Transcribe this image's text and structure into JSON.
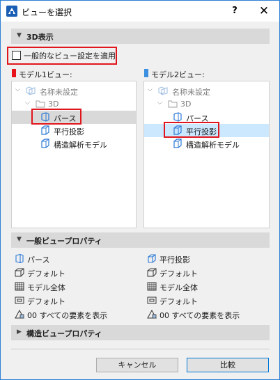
{
  "window": {
    "title": "ビューを選択",
    "help_label": "?",
    "close_label": "✕"
  },
  "section_3d": {
    "label": "3D表示"
  },
  "general_checkbox": {
    "label": "一般的なビュー設定を適用",
    "checked": false
  },
  "model1": {
    "header": "モデル1ビュー:",
    "color": "#e8141b",
    "tree": [
      {
        "label": "名称未設定"
      },
      {
        "label": "3D"
      },
      {
        "label": "パース",
        "selected": true
      },
      {
        "label": "平行投影"
      },
      {
        "label": "構造解析モデル"
      }
    ]
  },
  "model2": {
    "header": "モデル2ビュー:",
    "color": "#3d8fe0",
    "tree": [
      {
        "label": "名称未設定"
      },
      {
        "label": "3D"
      },
      {
        "label": "パース"
      },
      {
        "label": "平行投影",
        "selected": true
      },
      {
        "label": "構造解析モデル"
      }
    ]
  },
  "general_props": {
    "label": "一般ビュープロパティ",
    "left": [
      {
        "icon": "perspective-icon",
        "label": "パース"
      },
      {
        "icon": "camera-setting-icon",
        "label": "デフォルト"
      },
      {
        "icon": "model-extent-icon",
        "label": "モデル全体"
      },
      {
        "icon": "display-icon",
        "label": "デフォルト"
      },
      {
        "icon": "layer-icon",
        "label": "00 すべての要素を表示"
      }
    ],
    "right": [
      {
        "icon": "parallel-icon",
        "label": "平行投影"
      },
      {
        "icon": "camera-setting-icon",
        "label": "デフォルト"
      },
      {
        "icon": "model-extent-icon",
        "label": "モデル全体"
      },
      {
        "icon": "display-icon",
        "label": "デフォルト"
      },
      {
        "icon": "layer-icon",
        "label": "00 すべての要素を表示"
      }
    ]
  },
  "structural_props": {
    "label": "構造ビュープロパティ"
  },
  "buttons": {
    "cancel": "キャンセル",
    "compare": "比較"
  },
  "colors": {
    "highlight": "#e0161c",
    "selection_blue": "#cce8ff",
    "selection_gray": "#d9d9d9"
  }
}
